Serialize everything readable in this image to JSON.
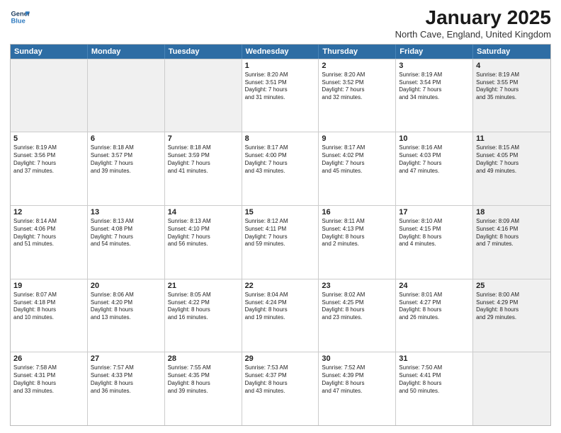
{
  "header": {
    "logo_line1": "General",
    "logo_line2": "Blue",
    "month_title": "January 2025",
    "location": "North Cave, England, United Kingdom"
  },
  "weekdays": [
    "Sunday",
    "Monday",
    "Tuesday",
    "Wednesday",
    "Thursday",
    "Friday",
    "Saturday"
  ],
  "rows": [
    [
      {
        "day": "",
        "text": "",
        "shaded": true
      },
      {
        "day": "",
        "text": "",
        "shaded": true
      },
      {
        "day": "",
        "text": "",
        "shaded": true
      },
      {
        "day": "1",
        "text": "Sunrise: 8:20 AM\nSunset: 3:51 PM\nDaylight: 7 hours\nand 31 minutes."
      },
      {
        "day": "2",
        "text": "Sunrise: 8:20 AM\nSunset: 3:52 PM\nDaylight: 7 hours\nand 32 minutes."
      },
      {
        "day": "3",
        "text": "Sunrise: 8:19 AM\nSunset: 3:54 PM\nDaylight: 7 hours\nand 34 minutes."
      },
      {
        "day": "4",
        "text": "Sunrise: 8:19 AM\nSunset: 3:55 PM\nDaylight: 7 hours\nand 35 minutes.",
        "shaded": true
      }
    ],
    [
      {
        "day": "5",
        "text": "Sunrise: 8:19 AM\nSunset: 3:56 PM\nDaylight: 7 hours\nand 37 minutes."
      },
      {
        "day": "6",
        "text": "Sunrise: 8:18 AM\nSunset: 3:57 PM\nDaylight: 7 hours\nand 39 minutes."
      },
      {
        "day": "7",
        "text": "Sunrise: 8:18 AM\nSunset: 3:59 PM\nDaylight: 7 hours\nand 41 minutes."
      },
      {
        "day": "8",
        "text": "Sunrise: 8:17 AM\nSunset: 4:00 PM\nDaylight: 7 hours\nand 43 minutes."
      },
      {
        "day": "9",
        "text": "Sunrise: 8:17 AM\nSunset: 4:02 PM\nDaylight: 7 hours\nand 45 minutes."
      },
      {
        "day": "10",
        "text": "Sunrise: 8:16 AM\nSunset: 4:03 PM\nDaylight: 7 hours\nand 47 minutes."
      },
      {
        "day": "11",
        "text": "Sunrise: 8:15 AM\nSunset: 4:05 PM\nDaylight: 7 hours\nand 49 minutes.",
        "shaded": true
      }
    ],
    [
      {
        "day": "12",
        "text": "Sunrise: 8:14 AM\nSunset: 4:06 PM\nDaylight: 7 hours\nand 51 minutes."
      },
      {
        "day": "13",
        "text": "Sunrise: 8:13 AM\nSunset: 4:08 PM\nDaylight: 7 hours\nand 54 minutes."
      },
      {
        "day": "14",
        "text": "Sunrise: 8:13 AM\nSunset: 4:10 PM\nDaylight: 7 hours\nand 56 minutes."
      },
      {
        "day": "15",
        "text": "Sunrise: 8:12 AM\nSunset: 4:11 PM\nDaylight: 7 hours\nand 59 minutes."
      },
      {
        "day": "16",
        "text": "Sunrise: 8:11 AM\nSunset: 4:13 PM\nDaylight: 8 hours\nand 2 minutes."
      },
      {
        "day": "17",
        "text": "Sunrise: 8:10 AM\nSunset: 4:15 PM\nDaylight: 8 hours\nand 4 minutes."
      },
      {
        "day": "18",
        "text": "Sunrise: 8:09 AM\nSunset: 4:16 PM\nDaylight: 8 hours\nand 7 minutes.",
        "shaded": true
      }
    ],
    [
      {
        "day": "19",
        "text": "Sunrise: 8:07 AM\nSunset: 4:18 PM\nDaylight: 8 hours\nand 10 minutes."
      },
      {
        "day": "20",
        "text": "Sunrise: 8:06 AM\nSunset: 4:20 PM\nDaylight: 8 hours\nand 13 minutes."
      },
      {
        "day": "21",
        "text": "Sunrise: 8:05 AM\nSunset: 4:22 PM\nDaylight: 8 hours\nand 16 minutes."
      },
      {
        "day": "22",
        "text": "Sunrise: 8:04 AM\nSunset: 4:24 PM\nDaylight: 8 hours\nand 19 minutes."
      },
      {
        "day": "23",
        "text": "Sunrise: 8:02 AM\nSunset: 4:25 PM\nDaylight: 8 hours\nand 23 minutes."
      },
      {
        "day": "24",
        "text": "Sunrise: 8:01 AM\nSunset: 4:27 PM\nDaylight: 8 hours\nand 26 minutes."
      },
      {
        "day": "25",
        "text": "Sunrise: 8:00 AM\nSunset: 4:29 PM\nDaylight: 8 hours\nand 29 minutes.",
        "shaded": true
      }
    ],
    [
      {
        "day": "26",
        "text": "Sunrise: 7:58 AM\nSunset: 4:31 PM\nDaylight: 8 hours\nand 33 minutes."
      },
      {
        "day": "27",
        "text": "Sunrise: 7:57 AM\nSunset: 4:33 PM\nDaylight: 8 hours\nand 36 minutes."
      },
      {
        "day": "28",
        "text": "Sunrise: 7:55 AM\nSunset: 4:35 PM\nDaylight: 8 hours\nand 39 minutes."
      },
      {
        "day": "29",
        "text": "Sunrise: 7:53 AM\nSunset: 4:37 PM\nDaylight: 8 hours\nand 43 minutes."
      },
      {
        "day": "30",
        "text": "Sunrise: 7:52 AM\nSunset: 4:39 PM\nDaylight: 8 hours\nand 47 minutes."
      },
      {
        "day": "31",
        "text": "Sunrise: 7:50 AM\nSunset: 4:41 PM\nDaylight: 8 hours\nand 50 minutes."
      },
      {
        "day": "",
        "text": "",
        "shaded": true
      }
    ]
  ]
}
